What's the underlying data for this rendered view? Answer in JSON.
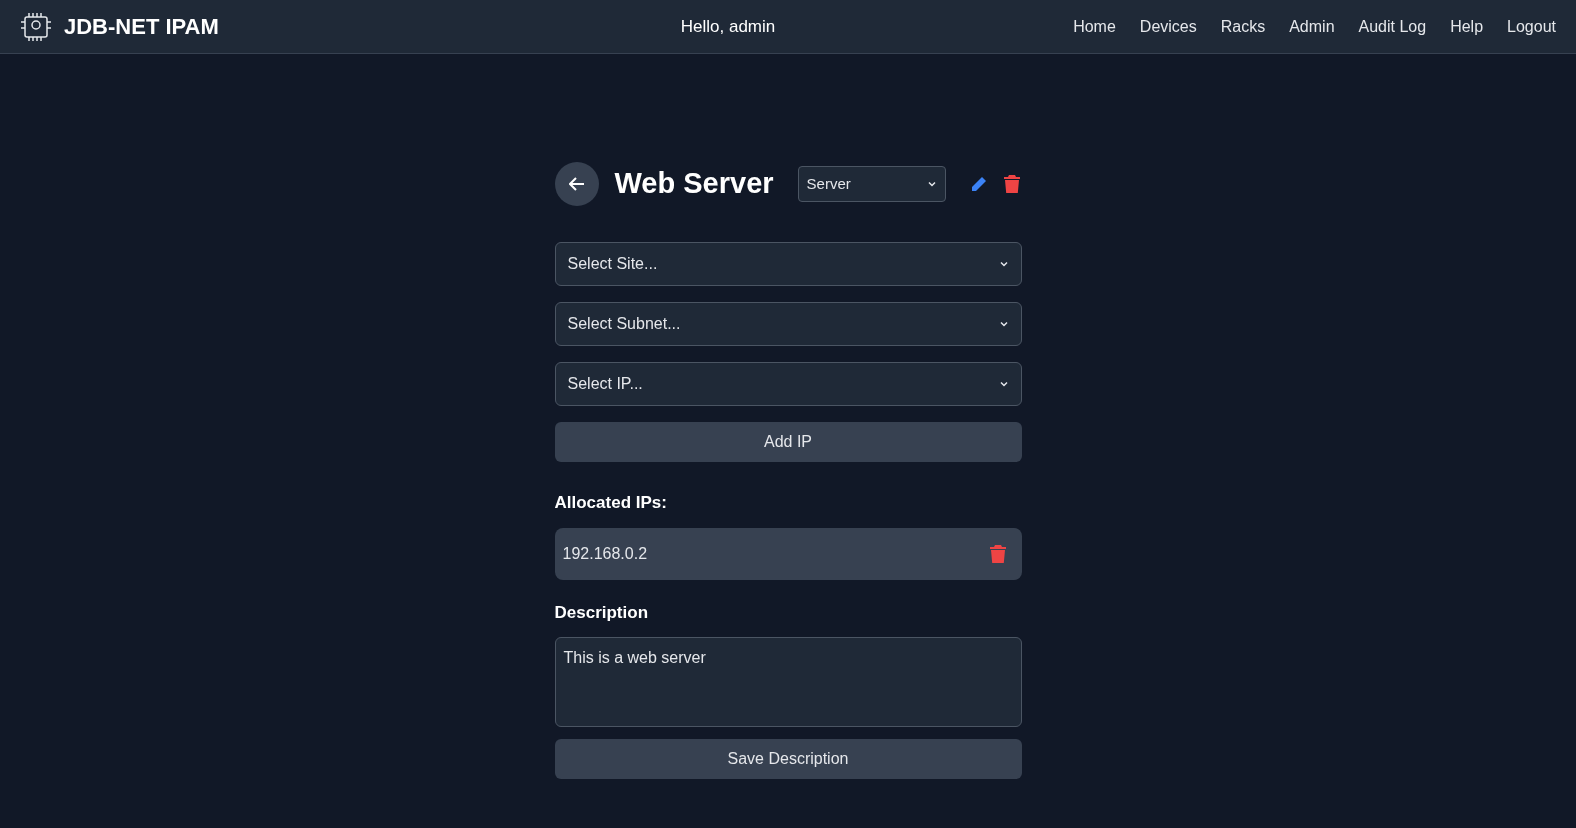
{
  "header": {
    "brand": "JDB-NET IPAM",
    "greeting": "Hello, admin",
    "nav": [
      "Home",
      "Devices",
      "Racks",
      "Admin",
      "Audit Log",
      "Help",
      "Logout"
    ]
  },
  "device": {
    "name": "Web Server",
    "type": "Server"
  },
  "selects": [
    {
      "placeholder": "Select Site..."
    },
    {
      "placeholder": "Select Subnet..."
    },
    {
      "placeholder": "Select IP..."
    }
  ],
  "add_button": "Add IP",
  "allocated": {
    "heading": "Allocated IPs:",
    "ips": [
      "192.168.0.2"
    ]
  },
  "description": {
    "heading": "Description",
    "value": "This is a web server",
    "save_button": "Save Description"
  }
}
